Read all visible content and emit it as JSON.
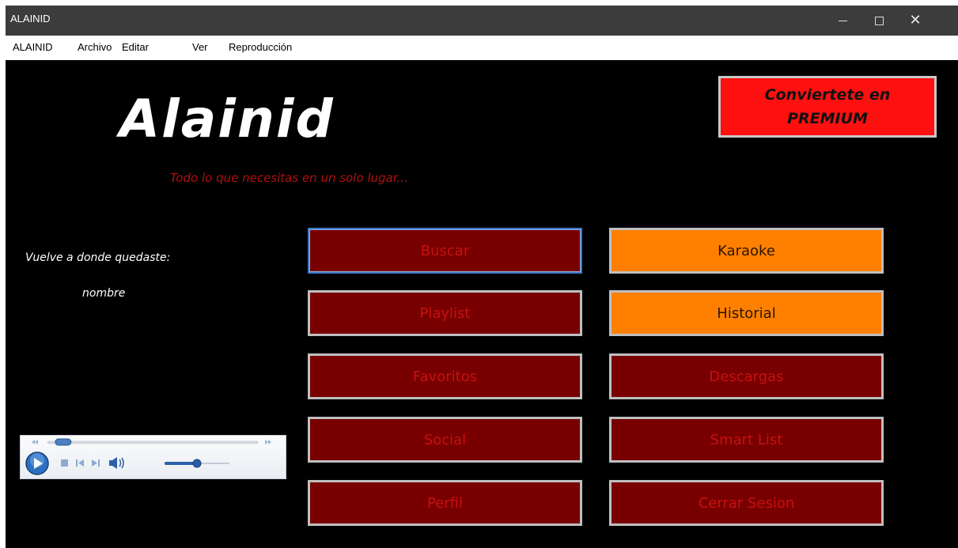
{
  "window": {
    "title": "ALAINID"
  },
  "menu": [
    "ALAINID",
    "Archivo",
    "Editar",
    "Ver",
    "Reproducción"
  ],
  "brand": {
    "logo": "Alainid",
    "tagline": "Todo lo que necesitas en un solo lugar...",
    "premium": "Conviertete en PREMIUM"
  },
  "resume": {
    "label": "Vuelve a donde quedaste:",
    "name": "nombre"
  },
  "buttons": {
    "buscar": "Buscar",
    "karaoke": "Karaoke",
    "playlist": "Playlist",
    "historial": "Historial",
    "favoritos": "Favoritos",
    "descargas": "Descargas",
    "social": "Social",
    "smart_list": "Smart List",
    "perfil": "Perfil",
    "cerrar_sesion": "Cerrar Sesion"
  },
  "colors": {
    "content_bg": "#000000",
    "button_red": "#780000",
    "button_red_text": "#c81010",
    "button_orange": "#ff8000",
    "premium_bg": "#ff1010",
    "tagline": "#b01010"
  },
  "player": {
    "seek_progress": 0.04,
    "volume": 0.5
  }
}
